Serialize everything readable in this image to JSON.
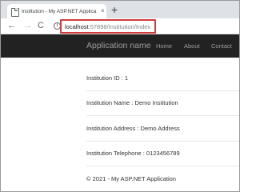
{
  "browser": {
    "tab": {
      "title": "Institution - My ASP.NET Applica",
      "close": "×"
    },
    "new_tab": "+",
    "nav": {
      "back": "←",
      "forward": "→",
      "reload": "C"
    },
    "info_icon": "i",
    "url": {
      "host": "localhost",
      "path": ":57898/Institution/Index"
    }
  },
  "app": {
    "brand": "Application name",
    "nav_items": [
      "Home",
      "About",
      "Contact"
    ]
  },
  "details": {
    "id": "Institution ID : 1",
    "name": "Institution Name : Demo Institution",
    "address": "Institution Address : Demo Address",
    "telephone": "Institution Telephone : 0123456789"
  },
  "footer": {
    "text": "© 2021 - My ASP.NET Application"
  },
  "colors": {
    "navbar_bg": "#222222",
    "nav_text": "#9d9d9d",
    "url_highlight": "#d23b3b",
    "tabstrip_bg": "#dee1e6"
  }
}
